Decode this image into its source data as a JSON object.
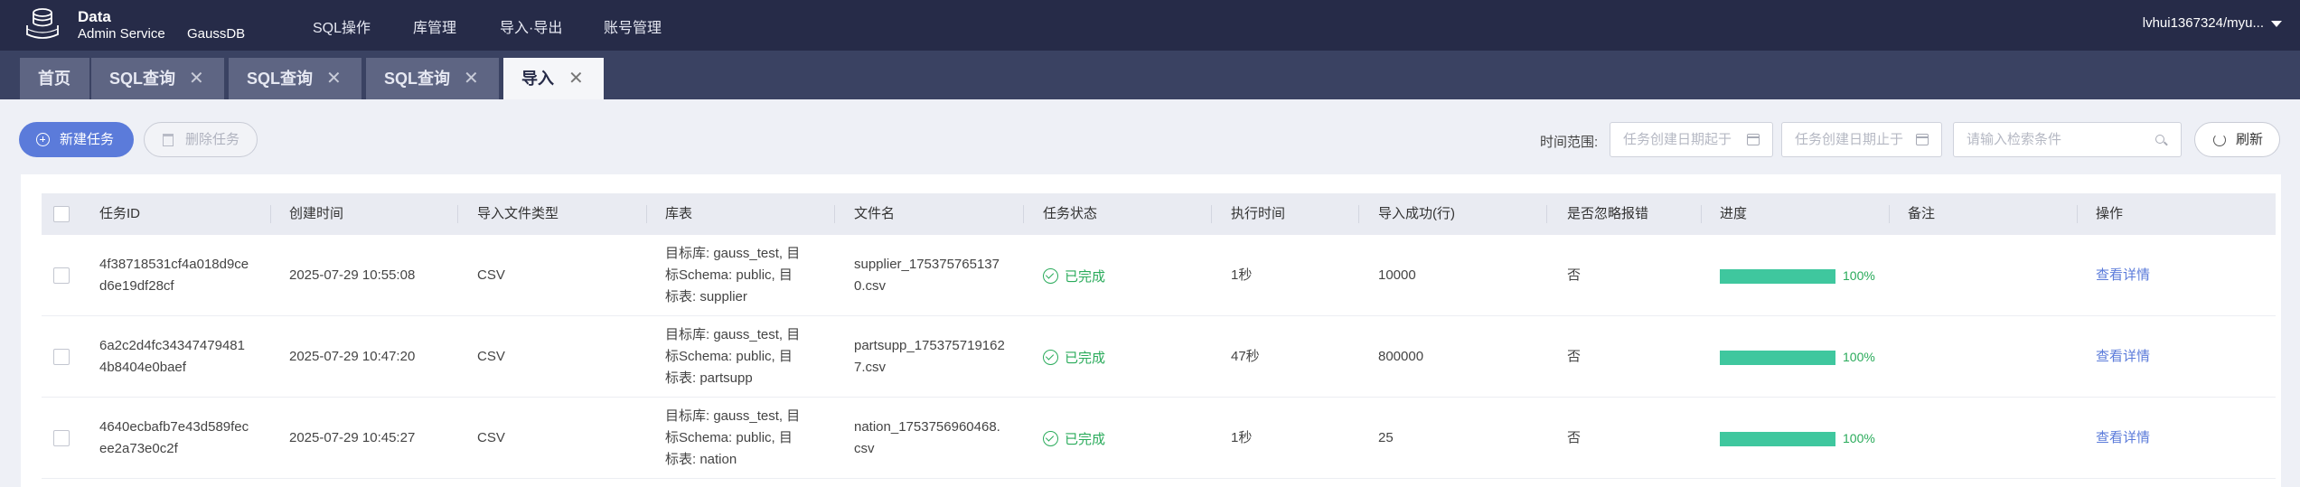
{
  "header": {
    "brand_line1": "Data",
    "brand_line2": "Admin Service",
    "brand_db": "GaussDB",
    "logo_icon": "database-icon",
    "nav": [
      "SQL操作",
      "库管理",
      "导入·导出",
      "账号管理"
    ],
    "user": "lvhui1367324/myu..."
  },
  "tabs": [
    {
      "label": "首页",
      "closable": false,
      "active": false
    },
    {
      "label": "SQL查询",
      "closable": true,
      "active": false
    },
    {
      "label": "SQL查询",
      "closable": true,
      "active": false
    },
    {
      "label": "SQL查询",
      "closable": true,
      "active": false
    },
    {
      "label": "导入",
      "closable": true,
      "active": true
    }
  ],
  "toolbar": {
    "new_task": "新建任务",
    "delete_task": "删除任务",
    "time_range_label": "时间范围:",
    "start_date_placeholder": "任务创建日期起于",
    "end_date_placeholder": "任务创建日期止于",
    "search_placeholder": "请输入检索条件",
    "refresh": "刷新"
  },
  "table": {
    "columns": [
      "任务ID",
      "创建时间",
      "导入文件类型",
      "库表",
      "文件名",
      "任务状态",
      "执行时间",
      "导入成功(行)",
      "是否忽略报错",
      "进度",
      "备注",
      "操作"
    ],
    "rows": [
      {
        "id_line1": "4f38718531cf4a018d9ce",
        "id_line2": "d6e19df28cf",
        "created": "2025-07-29 10:55:08",
        "file_type": "CSV",
        "lib_line1": "目标库: gauss_test, 目",
        "lib_line2": "标Schema: public, 目",
        "lib_line3": "标表: supplier",
        "file_line1": "supplier_175375765137",
        "file_line2": "0.csv",
        "status": "已完成",
        "exec_time": "1秒",
        "success_rows": "10000",
        "ignore_error": "否",
        "progress": 100,
        "progress_text": "100%",
        "remark": "",
        "action": "查看详情"
      },
      {
        "id_line1": "6a2c2d4fc34347479481",
        "id_line2": "4b8404e0baef",
        "created": "2025-07-29 10:47:20",
        "file_type": "CSV",
        "lib_line1": "目标库: gauss_test, 目",
        "lib_line2": "标Schema: public, 目",
        "lib_line3": "标表: partsupp",
        "file_line1": "partsupp_175375719162",
        "file_line2": "7.csv",
        "status": "已完成",
        "exec_time": "47秒",
        "success_rows": "800000",
        "ignore_error": "否",
        "progress": 100,
        "progress_text": "100%",
        "remark": "",
        "action": "查看详情"
      },
      {
        "id_line1": "4640ecbafb7e43d589fec",
        "id_line2": "ee2a73e0c2f",
        "created": "2025-07-29 10:45:27",
        "file_type": "CSV",
        "lib_line1": "目标库: gauss_test, 目",
        "lib_line2": "标Schema: public, 目",
        "lib_line3": "标表: nation",
        "file_line1": "nation_1753756960468.",
        "file_line2": "csv",
        "status": "已完成",
        "exec_time": "1秒",
        "success_rows": "25",
        "ignore_error": "否",
        "progress": 100,
        "progress_text": "100%",
        "remark": "",
        "action": "查看详情"
      }
    ]
  },
  "colors": {
    "topbar": "#262b48",
    "tabbar": "#3a4262",
    "primary": "#5b7bda",
    "success": "#2aab5b",
    "progress": "#3fc79e"
  }
}
